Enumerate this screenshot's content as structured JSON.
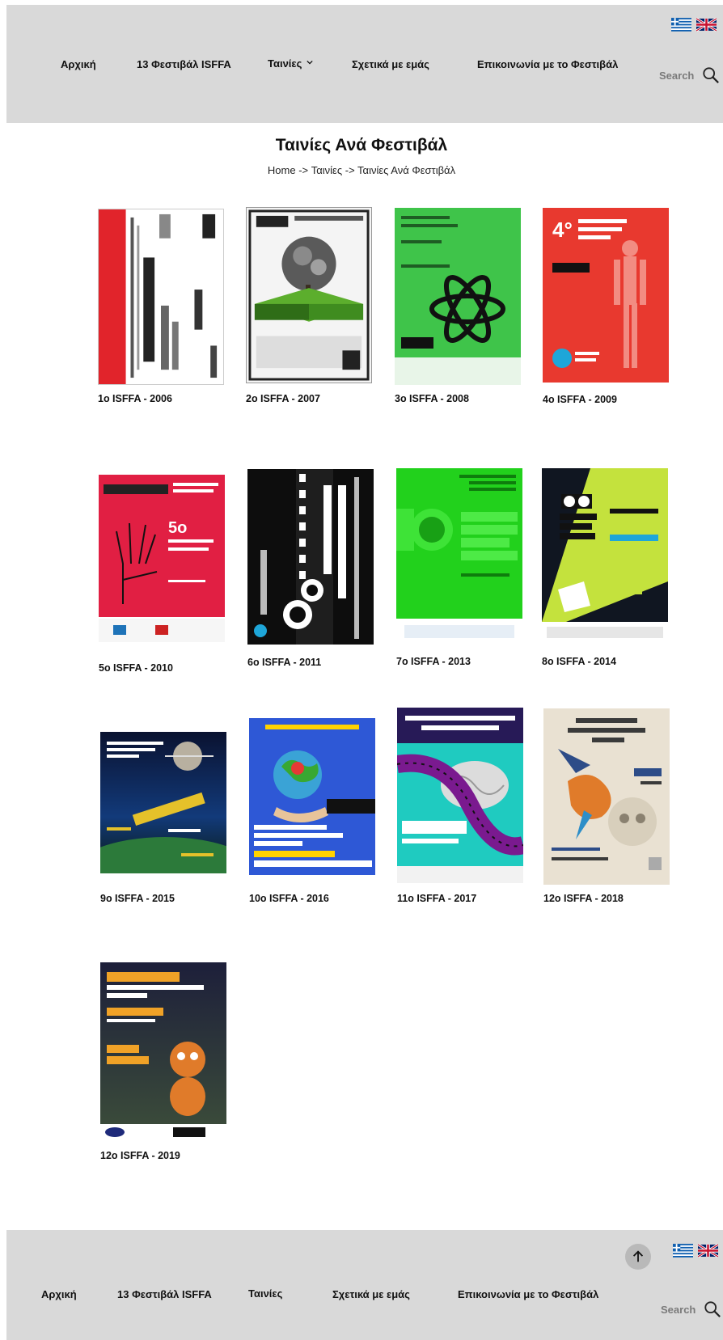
{
  "header": {
    "nav": [
      {
        "label": "Αρχική"
      },
      {
        "label": "13 Φεστιβάλ ISFFA"
      },
      {
        "label": "Ταινίες"
      },
      {
        "label": "Σχετικά με εμάς"
      },
      {
        "label": "Επικοινωνία με το Φεστιβάλ"
      }
    ],
    "search_label": "Search",
    "languages": [
      "greek-flag-icon",
      "uk-flag-icon"
    ]
  },
  "page": {
    "title": "Ταινίες Ανά Φεστιβάλ",
    "breadcrumb": {
      "home": "Home",
      "sep1": " -> ",
      "section": "Ταινίες",
      "sep2": " -> ",
      "current": "Ταινίες Ανά Φεστιβάλ"
    }
  },
  "festivals": [
    {
      "caption": "1o ISFFA - 2006",
      "poster_color": "#ffffff",
      "accent": "#e1242b"
    },
    {
      "caption": "2o ISFFA - 2007",
      "poster_color": "#ffffff",
      "accent": "#3a3a3a"
    },
    {
      "caption": "3o ISFFA - 2008",
      "poster_color": "#3fc44a",
      "accent": "#111111"
    },
    {
      "caption": "4o ISFFA - 2009",
      "poster_color": "#e8392f",
      "accent": "#f28c82"
    },
    {
      "caption": "5o ISFFA - 2010",
      "poster_color": "#e11f43",
      "accent": "#111111"
    },
    {
      "caption": "6o ISFFA - 2011",
      "poster_color": "#0d0d0d",
      "accent": "#ffffff"
    },
    {
      "caption": "7o ISFFA - 2013",
      "poster_color": "#22d11c",
      "accent": "#0e7d0d"
    },
    {
      "caption": "8o ISFFA - 2014",
      "poster_color": "#101621",
      "accent": "#c4e23d"
    },
    {
      "caption": "9o ISFFA - 2015",
      "poster_color": "#0a1230",
      "accent": "#e5c12a"
    },
    {
      "caption": "10o ISFFA - 2016",
      "poster_color": "#2e58d6",
      "accent": "#ffd200"
    },
    {
      "caption": "11o ISFFA - 2017",
      "poster_color": "#1fcbc0",
      "accent": "#7a1a8f"
    },
    {
      "caption": "12o ISFFA - 2018",
      "poster_color": "#e9e1d2",
      "accent": "#2d4c88"
    },
    {
      "caption": "12o ISFFA - 2019",
      "poster_color": "#1d1f3a",
      "accent": "#f0a227"
    }
  ],
  "footer": {
    "nav": [
      {
        "label": "Αρχική"
      },
      {
        "label": "13 Φεστιβάλ ISFFA"
      },
      {
        "label": "Ταινίες"
      },
      {
        "label": "Σχετικά με εμάς"
      },
      {
        "label": "Επικοινωνία με το Φεστιβάλ"
      }
    ],
    "search_label": "Search"
  }
}
